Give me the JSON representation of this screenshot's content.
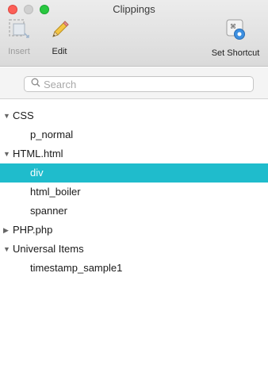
{
  "window": {
    "title": "Clippings"
  },
  "toolbar": {
    "insert_label": "Insert",
    "edit_label": "Edit",
    "shortcut_label": "Set Shortcut"
  },
  "search": {
    "placeholder": "Search",
    "value": ""
  },
  "tree": [
    {
      "type": "group",
      "label": "CSS",
      "expanded": true,
      "glyph": "▼"
    },
    {
      "type": "item",
      "label": "p_normal"
    },
    {
      "type": "group",
      "label": "HTML.html",
      "expanded": true,
      "glyph": "▼"
    },
    {
      "type": "item",
      "label": "div",
      "selected": true
    },
    {
      "type": "item",
      "label": "html_boiler"
    },
    {
      "type": "item",
      "label": "spanner"
    },
    {
      "type": "group",
      "label": "PHP.php",
      "expanded": false,
      "glyph": "▶"
    },
    {
      "type": "group",
      "label": "Universal Items",
      "expanded": true,
      "glyph": "▼"
    },
    {
      "type": "item",
      "label": "timestamp_sample1"
    }
  ],
  "colors": {
    "selection": "#1fbccc",
    "close": "#fc5f57",
    "maximize": "#29c840"
  },
  "icons": {
    "insert": "insert-icon",
    "edit": "pencil-icon",
    "shortcut": "keyboard-shortcut-icon",
    "search": "magnifier-icon"
  }
}
